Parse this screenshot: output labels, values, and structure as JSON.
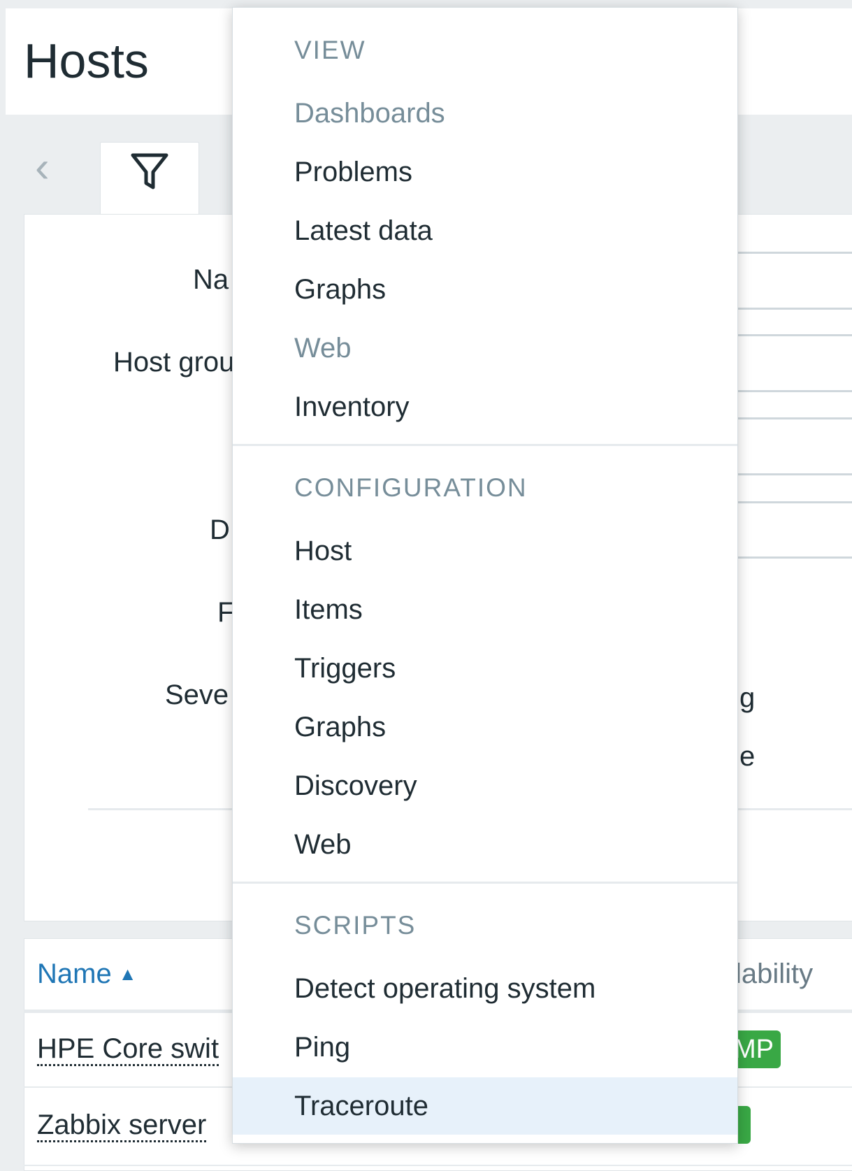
{
  "page": {
    "title": "Hosts"
  },
  "filter": {
    "labels": {
      "name": "Na",
      "host_groups": "Host grou",
      "dns": "D",
      "port": "F",
      "severity": "Seve"
    },
    "severity_fragments": [
      "g",
      "e"
    ]
  },
  "table": {
    "header_name": "Name",
    "sort_icon": "▲",
    "header_availability": "lability",
    "rows": [
      {
        "name": "HPE Core swit",
        "badge": "MP"
      },
      {
        "name": "Zabbix server",
        "badge": ""
      }
    ]
  },
  "menu": {
    "sections": [
      {
        "title": "VIEW",
        "items": [
          {
            "label": "Dashboards",
            "disabled": true
          },
          {
            "label": "Problems"
          },
          {
            "label": "Latest data"
          },
          {
            "label": "Graphs"
          },
          {
            "label": "Web",
            "disabled": true
          },
          {
            "label": "Inventory"
          }
        ]
      },
      {
        "title": "CONFIGURATION",
        "items": [
          {
            "label": "Host"
          },
          {
            "label": "Items"
          },
          {
            "label": "Triggers"
          },
          {
            "label": "Graphs"
          },
          {
            "label": "Discovery"
          },
          {
            "label": "Web"
          }
        ]
      },
      {
        "title": "SCRIPTS",
        "items": [
          {
            "label": "Detect operating system"
          },
          {
            "label": "Ping"
          },
          {
            "label": "Traceroute",
            "active": true
          }
        ]
      }
    ]
  },
  "icons": {
    "back": "chevron-left-icon",
    "filter": "filter-icon"
  },
  "colors": {
    "link": "#1f76b5",
    "muted": "#768d99",
    "badge_green": "#39a845",
    "hover": "#e7f1fa"
  }
}
